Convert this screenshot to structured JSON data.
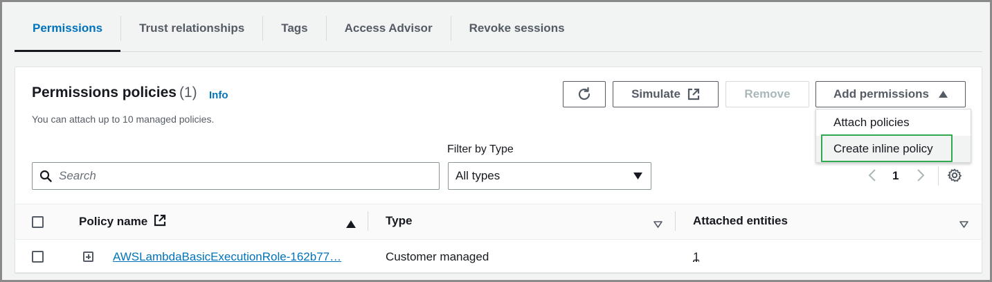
{
  "tabs": [
    {
      "label": "Permissions",
      "active": true
    },
    {
      "label": "Trust relationships",
      "active": false
    },
    {
      "label": "Tags",
      "active": false
    },
    {
      "label": "Access Advisor",
      "active": false
    },
    {
      "label": "Revoke sessions",
      "active": false
    }
  ],
  "panel": {
    "title": "Permissions policies",
    "count": "(1)",
    "info_link": "Info",
    "description": "You can attach up to 10 managed policies."
  },
  "toolbar": {
    "refresh_icon": "refresh-icon",
    "simulate_label": "Simulate",
    "remove_label": "Remove",
    "add_permissions_label": "Add permissions"
  },
  "add_permissions_menu": {
    "items": [
      "Attach policies",
      "Create inline policy"
    ],
    "highlighted": "Create inline policy"
  },
  "filters": {
    "search_placeholder": "Search",
    "filter_label": "Filter by Type",
    "filter_value": "All types"
  },
  "pagination": {
    "current_page": "1"
  },
  "table": {
    "columns": [
      "Policy name",
      "Type",
      "Attached entities"
    ],
    "rows": [
      {
        "policy_name": "AWSLambdaBasicExecutionRole-162b77…",
        "type": "Customer managed",
        "attached_entities": "1"
      }
    ]
  },
  "colors": {
    "accent": "#0073bb",
    "highlight_box": "#2fa84f",
    "text": "#16191f",
    "muted": "#545b64"
  }
}
